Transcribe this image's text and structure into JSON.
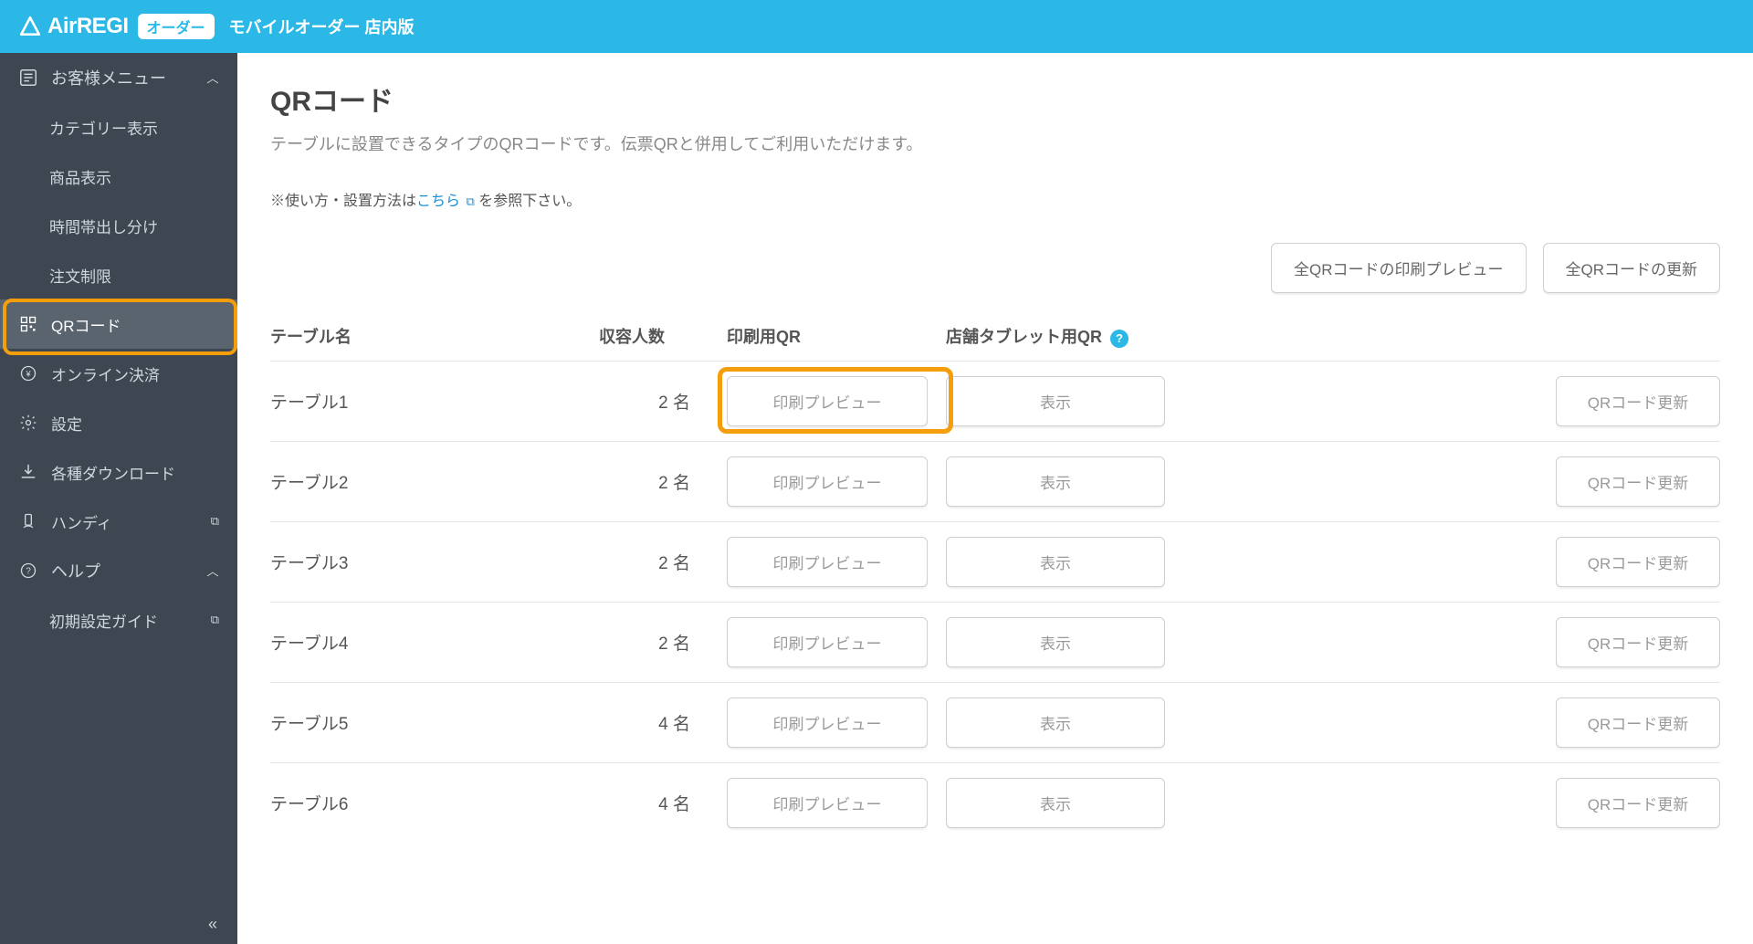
{
  "header": {
    "brand_main": "AirREGI",
    "brand_badge": "オーダー",
    "subtitle": "モバイルオーダー 店内版"
  },
  "sidebar": {
    "customer_menu": "お客様メニュー",
    "items": {
      "category": "カテゴリー表示",
      "product": "商品表示",
      "timeslot": "時間帯出し分け",
      "order_limit": "注文制限",
      "qr": "QRコード",
      "online_pay": "オンライン決済",
      "settings": "設定",
      "downloads": "各種ダウンロード",
      "handy": "ハンディ",
      "help": "ヘルプ",
      "init_guide": "初期設定ガイド"
    }
  },
  "page": {
    "title": "QRコード",
    "description": "テーブルに設置できるタイプのQRコードです。伝票QRと併用してご利用いただけます。",
    "usage_prefix": "※使い方・設置方法は",
    "usage_link": "こちら",
    "usage_suffix": "を参照下さい。"
  },
  "actions": {
    "preview_all": "全QRコードの印刷プレビュー",
    "refresh_all": "全QRコードの更新"
  },
  "table": {
    "headers": {
      "name": "テーブル名",
      "capacity": "収容人数",
      "print_qr": "印刷用QR",
      "tablet_qr": "店舗タブレット用QR"
    },
    "buttons": {
      "preview": "印刷プレビュー",
      "show": "表示",
      "refresh": "QRコード更新"
    },
    "rows": [
      {
        "name": "テーブル1",
        "capacity": "2 名"
      },
      {
        "name": "テーブル2",
        "capacity": "2 名"
      },
      {
        "name": "テーブル3",
        "capacity": "2 名"
      },
      {
        "name": "テーブル4",
        "capacity": "2 名"
      },
      {
        "name": "テーブル5",
        "capacity": "4 名"
      },
      {
        "name": "テーブル6",
        "capacity": "4 名"
      }
    ]
  }
}
